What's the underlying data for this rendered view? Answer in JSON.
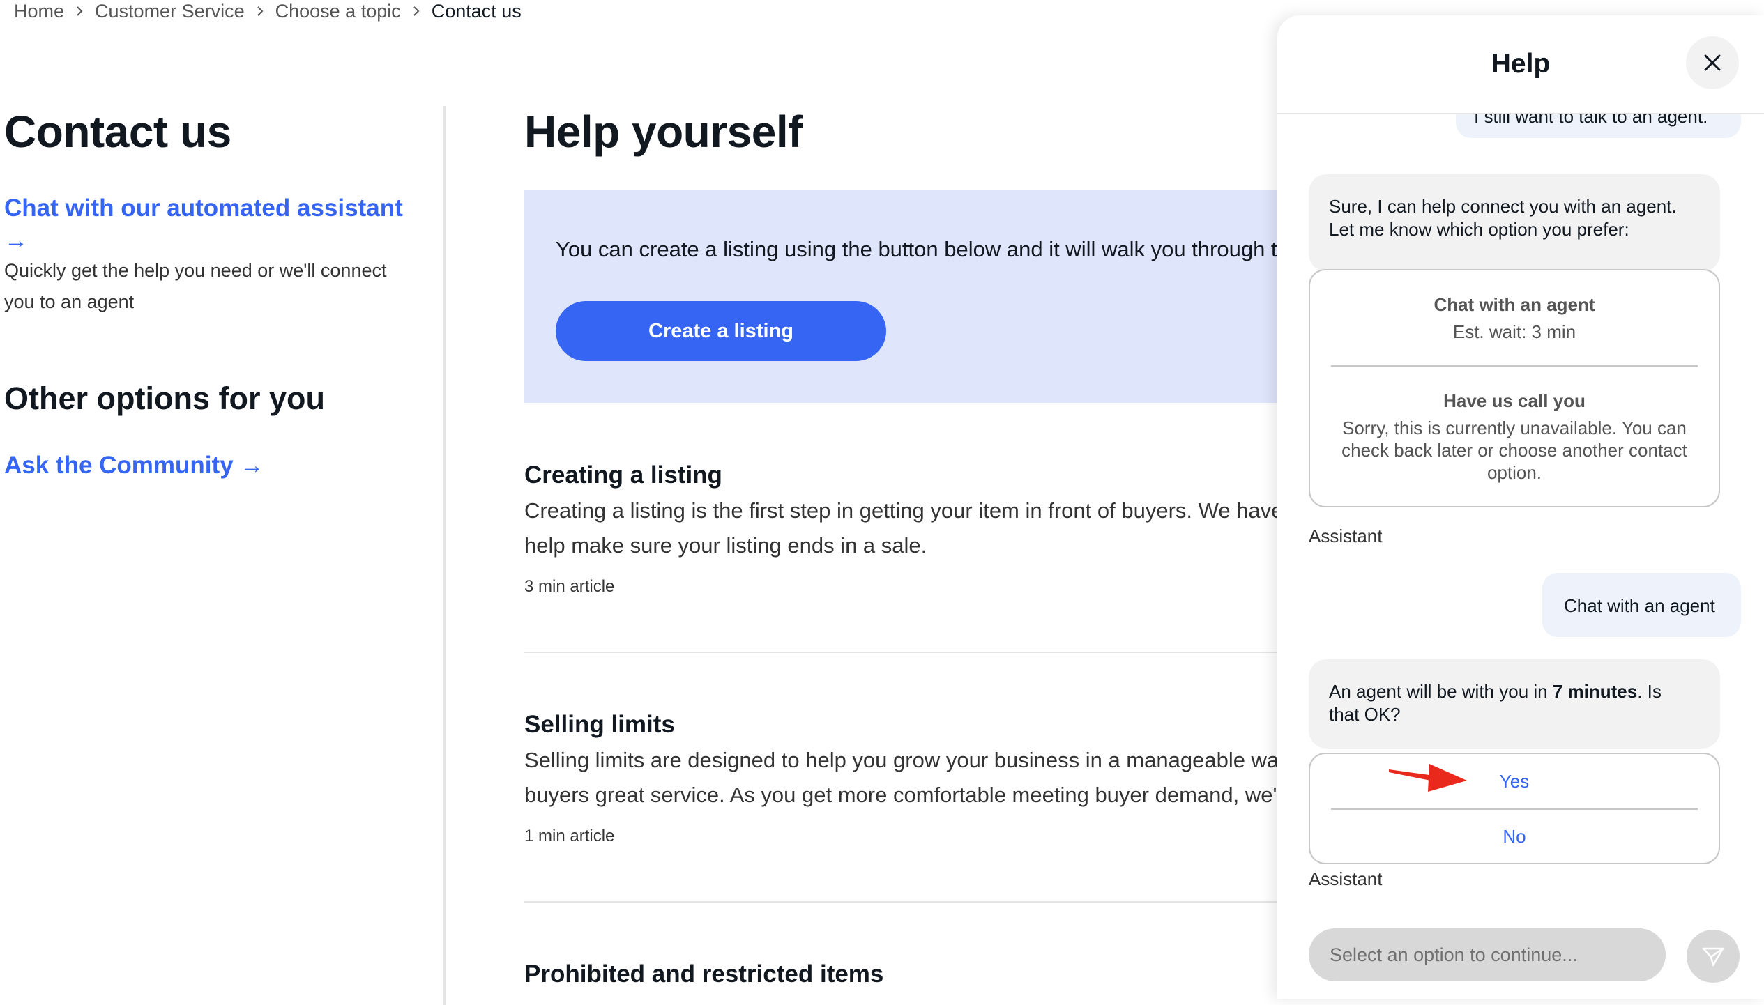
{
  "breadcrumb": [
    "Home",
    "Customer Service",
    "Choose a topic",
    "Contact us"
  ],
  "left": {
    "title": "Contact us",
    "assistant_link": "Chat with our automated assistant",
    "assistant_arrow": "→",
    "assistant_desc": "Quickly get the help you need or we'll connect you to an agent",
    "other_title": "Other options for you",
    "community_link": "Ask the Community",
    "community_arrow": "→"
  },
  "main": {
    "title": "Help yourself",
    "promo_text": "You can create a listing using the button below and it will walk you through the",
    "create_button": "Create a listing",
    "articles": [
      {
        "title": "Creating a listing",
        "line1": "Creating a listing is the first step in getting your item in front of buyers. We have",
        "line2": "help make sure your listing ends in a sale.",
        "meta": "3 min article"
      },
      {
        "title": "Selling limits",
        "line1": "Selling limits are designed to help you grow your business in a manageable way",
        "line2": "buyers great service. As you get more comfortable meeting buyer demand, we'll",
        "meta": "1 min article"
      },
      {
        "title": "Prohibited and restricted items"
      }
    ]
  },
  "help_panel": {
    "title": "Help",
    "close_icon": "close-icon",
    "messages": {
      "user_1": "I still want to talk to an agent.",
      "bot_1_line1": "Sure, I can help connect you with an agent.",
      "bot_1_line2": "Let me know which option you prefer:",
      "option_chat_title": "Chat with an agent",
      "option_chat_sub": "Est. wait: 3 min",
      "option_call_title": "Have us call you",
      "option_call_sub_1": "Sorry, this is currently unavailable. You can",
      "option_call_sub_2": "check back later or choose another contact",
      "option_call_sub_3": "option.",
      "sender_1": "Assistant",
      "user_2": "Chat with an agent",
      "bot_2_pre": "An agent will be with you in ",
      "bot_2_bold": "7 minutes",
      "bot_2_post": ". Is",
      "bot_2_line2": "that OK?",
      "yes": "Yes",
      "no": "No",
      "sender_2": "Assistant"
    },
    "input_placeholder": "Select an option to continue...",
    "send_icon": "send-icon",
    "annotation_color": "#e8291c"
  }
}
